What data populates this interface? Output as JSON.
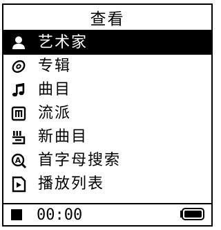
{
  "header": {
    "title": "查看"
  },
  "menu": {
    "items": [
      {
        "label": "艺术家",
        "icon": "artist-icon",
        "selected": true
      },
      {
        "label": "专辑",
        "icon": "album-icon",
        "selected": false
      },
      {
        "label": "曲目",
        "icon": "music-note-icon",
        "selected": false
      },
      {
        "label": "流派",
        "icon": "genre-icon",
        "selected": false
      },
      {
        "label": "新曲目",
        "icon": "new-track-icon",
        "selected": false
      },
      {
        "label": "首字母搜索",
        "icon": "search-icon",
        "selected": false
      },
      {
        "label": "播放列表",
        "icon": "playlist-icon",
        "selected": false
      }
    ]
  },
  "status": {
    "playback_state": "stop-icon",
    "time": "00:00",
    "battery_icon": "battery-icon",
    "battery_level": 1.0
  },
  "colors": {
    "foreground": "#000000",
    "background": "#ffffff",
    "selection": "#000000"
  }
}
